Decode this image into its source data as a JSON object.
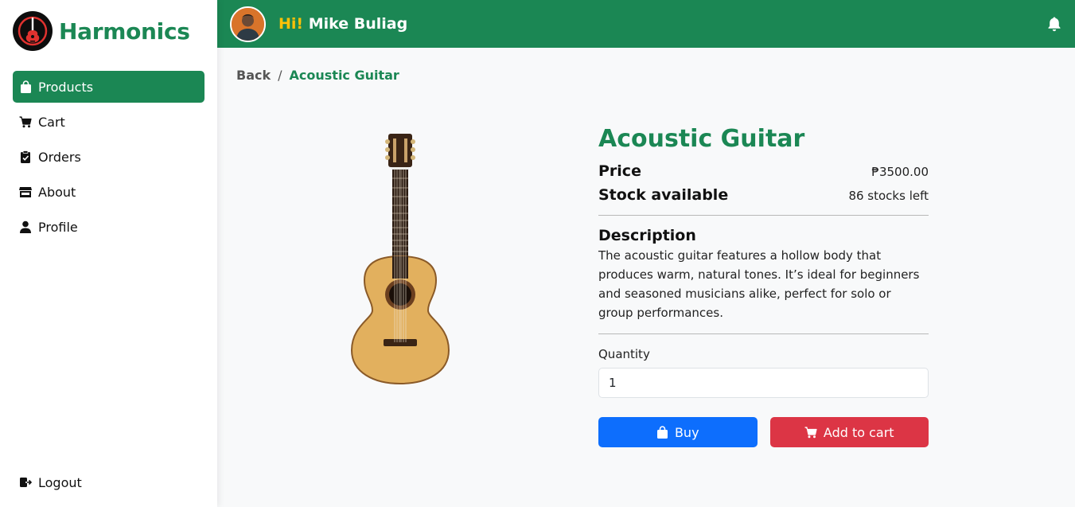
{
  "brand": {
    "name": "Harmonics",
    "logo_icon": "guitar-logo-icon"
  },
  "sidebar": {
    "items": [
      {
        "label": "Products",
        "icon": "bag-icon",
        "active": true
      },
      {
        "label": "Cart",
        "icon": "cart-icon",
        "active": false
      },
      {
        "label": "Orders",
        "icon": "clipboard-icon",
        "active": false
      },
      {
        "label": "About",
        "icon": "store-icon",
        "active": false
      },
      {
        "label": "Profile",
        "icon": "person-icon",
        "active": false
      }
    ],
    "logout_label": "Logout"
  },
  "header": {
    "greeting_hi": "Hi!",
    "user_name": "Mike Buliag",
    "bell_icon": "bell-icon"
  },
  "breadcrumb": {
    "back": "Back",
    "separator": "/",
    "current": "Acoustic Guitar"
  },
  "product": {
    "title": "Acoustic Guitar",
    "price_label": "Price",
    "price_value": "₱3500.00",
    "stock_label": "Stock available",
    "stock_value": "86 stocks left",
    "description_title": "Description",
    "description": "The acoustic guitar features a hollow body that produces warm, natural tones. It’s ideal for beginners and seasoned musicians alike, perfect for solo or group performances.",
    "quantity_label": "Quantity",
    "quantity_value": "1"
  },
  "actions": {
    "buy_label": "Buy",
    "add_to_cart_label": "Add to cart"
  },
  "colors": {
    "brand_green": "#1b8754",
    "buy_blue": "#0d6efd",
    "cart_red": "#dc3545",
    "greeting_yellow": "#ffc107"
  }
}
